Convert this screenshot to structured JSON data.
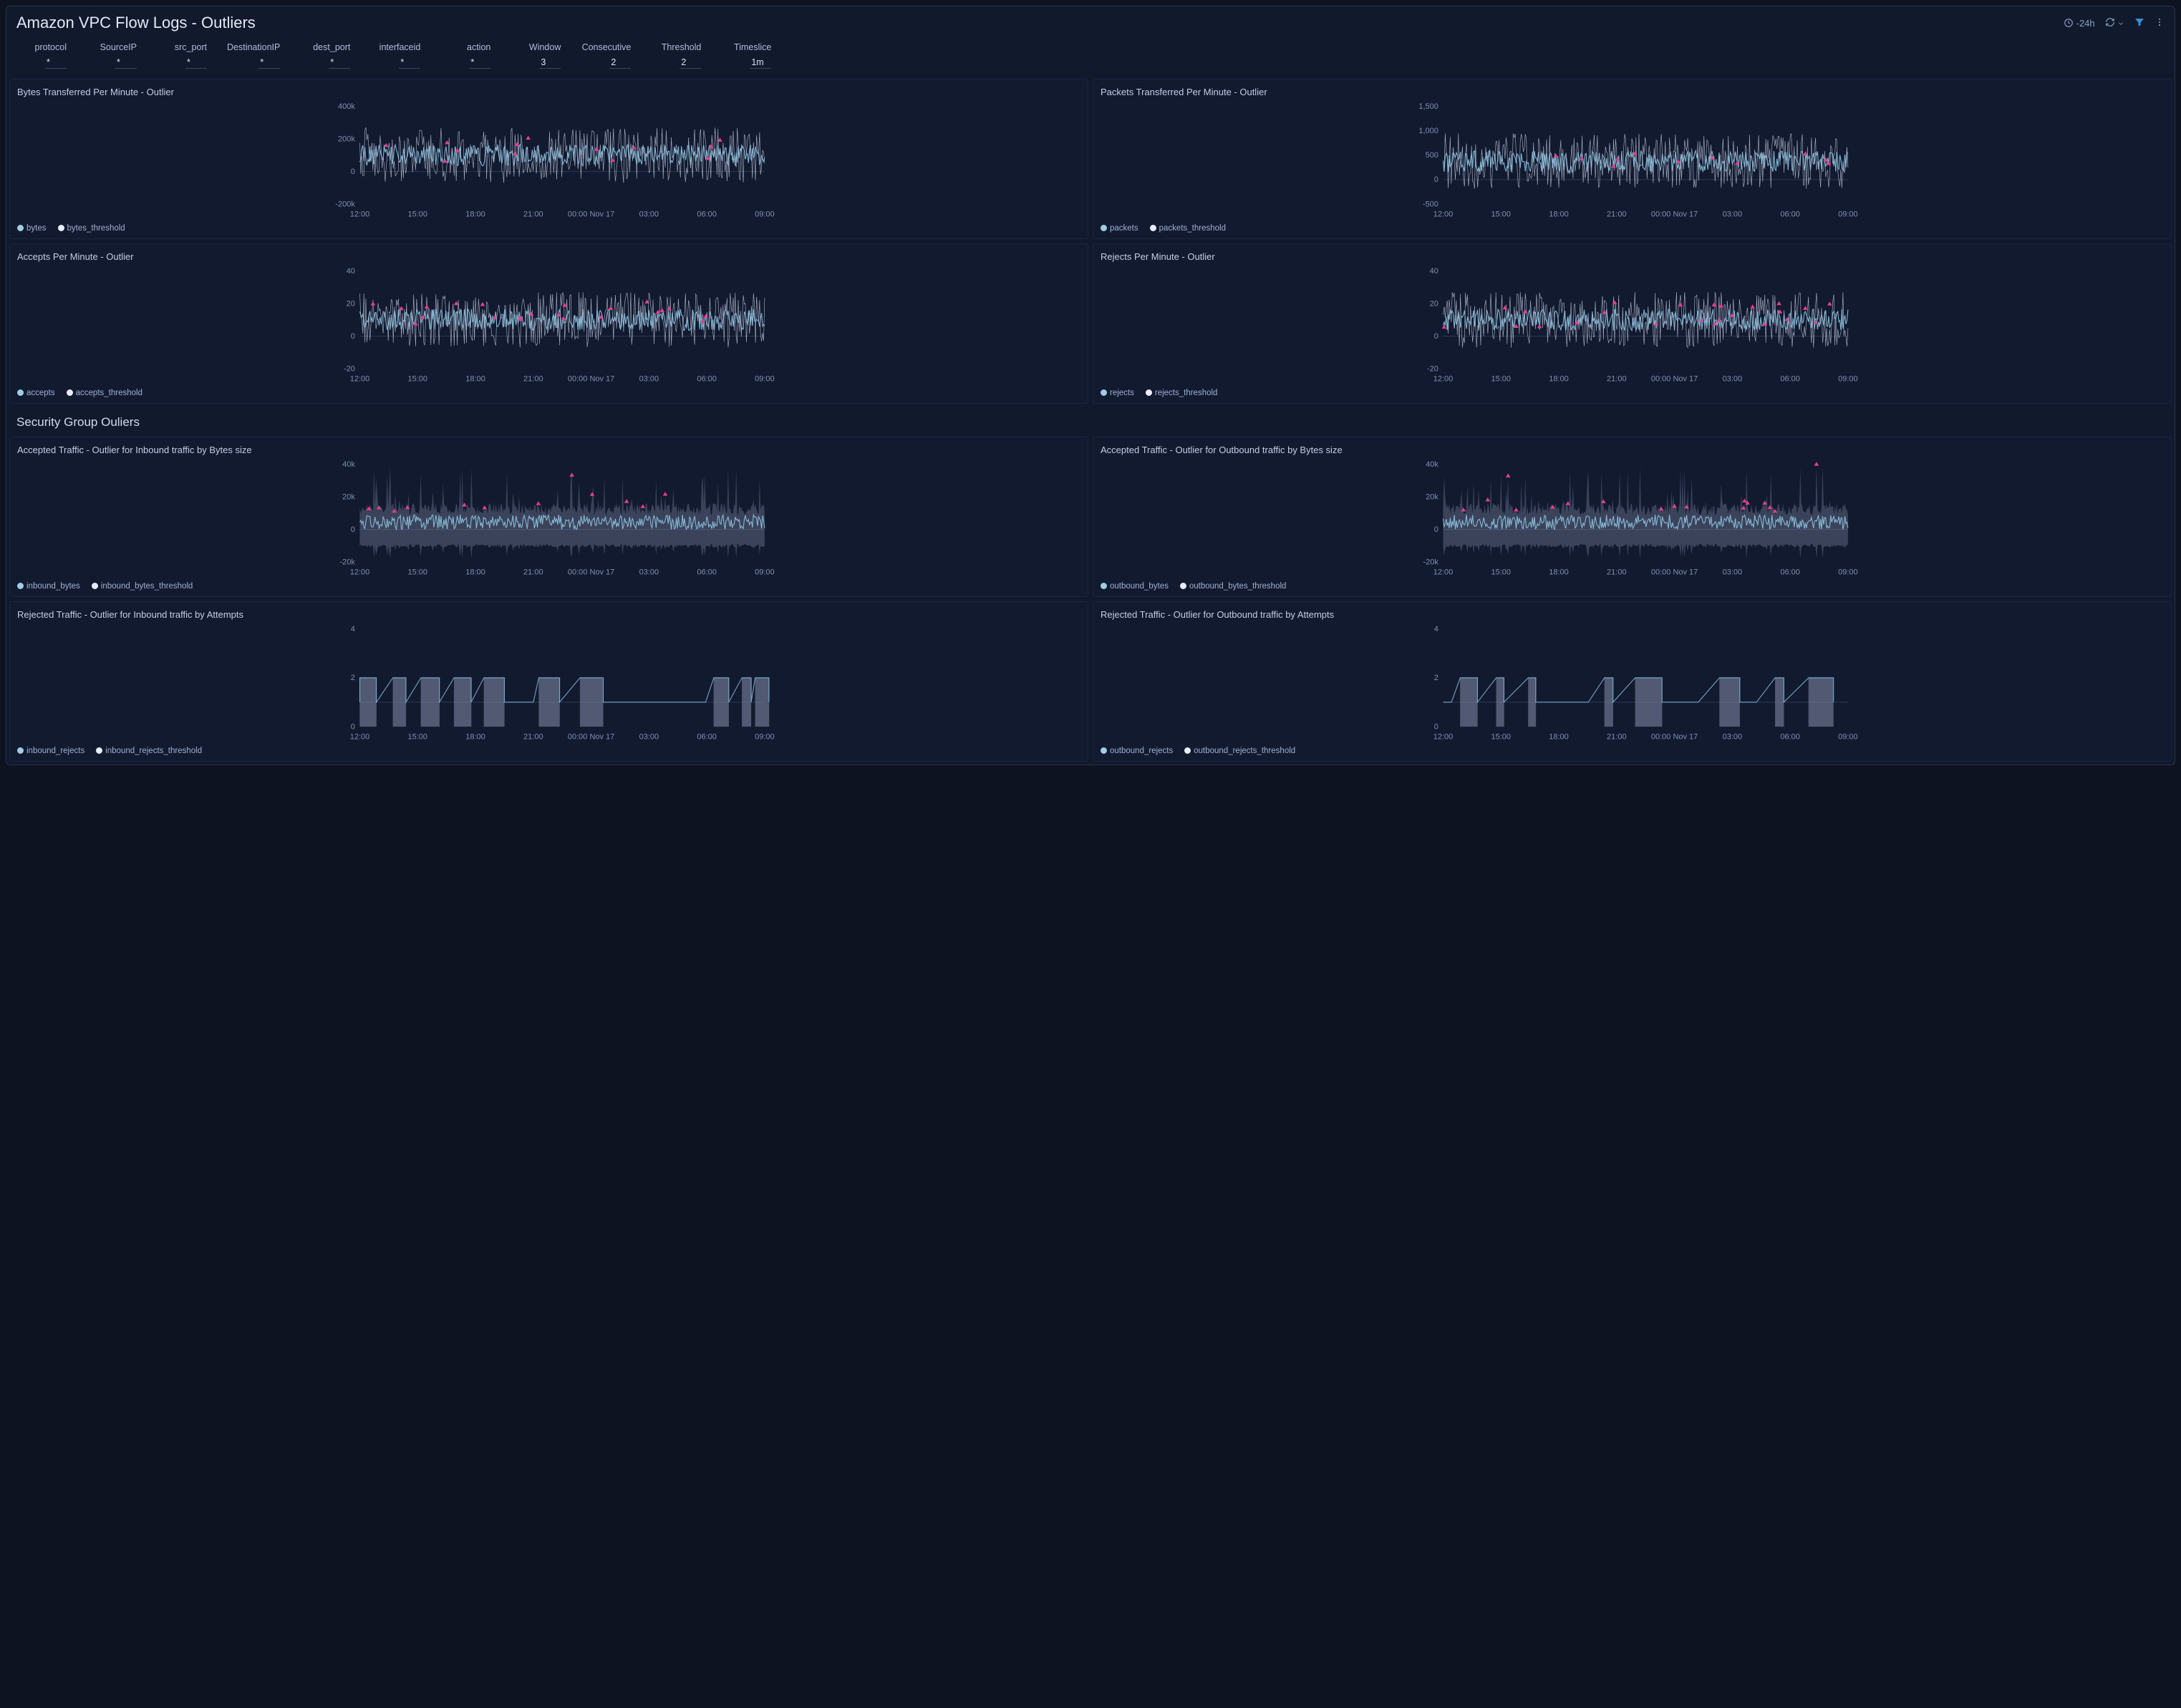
{
  "header": {
    "title": "Amazon VPC Flow Logs - Outliers",
    "timerange": "-24h"
  },
  "filters": [
    {
      "label": "protocol",
      "value": "*"
    },
    {
      "label": "SourceIP",
      "value": "*"
    },
    {
      "label": "src_port",
      "value": "*"
    },
    {
      "label": "DestinationIP",
      "value": "*"
    },
    {
      "label": "dest_port",
      "value": "*"
    },
    {
      "label": "interfaceid",
      "value": "*"
    },
    {
      "label": "action",
      "value": "*"
    },
    {
      "label": "Window",
      "value": "3"
    },
    {
      "label": "Consecutive",
      "value": "2"
    },
    {
      "label": "Threshold",
      "value": "2"
    },
    {
      "label": "Timeslice",
      "value": "1m"
    }
  ],
  "section2_title": "Security Group Ouliers",
  "chart_data": [
    {
      "id": "bytes",
      "title": "Bytes Transferred Per Minute - Outlier",
      "type": "line",
      "xlabel": "",
      "ylabel": "",
      "ylim": [
        -200000,
        400000
      ],
      "yticks": [
        "-200k",
        "0",
        "200k",
        "400k"
      ],
      "x_ticks": [
        "12:00",
        "15:00",
        "18:00",
        "21:00",
        "00:00 Nov 17",
        "03:00",
        "06:00",
        "09:00"
      ],
      "series": [
        {
          "name": "bytes",
          "color": "main"
        },
        {
          "name": "bytes_threshold",
          "color": "thresh"
        }
      ],
      "notes": "dense noisy band ~0–150k with scattered pink outlier markers across full window"
    },
    {
      "id": "packets",
      "title": "Packets Transferred Per Minute - Outlier",
      "type": "line",
      "ylim": [
        -500,
        1500
      ],
      "yticks": [
        "-500",
        "0",
        "500",
        "1,000",
        "1,500"
      ],
      "x_ticks": [
        "12:00",
        "15:00",
        "18:00",
        "21:00",
        "00:00 Nov 17",
        "03:00",
        "06:00",
        "09:00"
      ],
      "series": [
        {
          "name": "packets",
          "color": "main"
        },
        {
          "name": "packets_threshold",
          "color": "thresh"
        }
      ]
    },
    {
      "id": "accepts",
      "title": "Accepts Per Minute - Outlier",
      "type": "line",
      "ylim": [
        -20,
        40
      ],
      "yticks": [
        "-20",
        "0",
        "20",
        "40"
      ],
      "x_ticks": [
        "12:00",
        "15:00",
        "18:00",
        "21:00",
        "00:00 Nov 17",
        "03:00",
        "06:00",
        "09:00"
      ],
      "series": [
        {
          "name": "accepts",
          "color": "main"
        },
        {
          "name": "accepts_threshold",
          "color": "thresh"
        }
      ]
    },
    {
      "id": "rejects",
      "title": "Rejects Per Minute - Outlier",
      "type": "line",
      "ylim": [
        -20,
        40
      ],
      "yticks": [
        "-20",
        "0",
        "20",
        "40"
      ],
      "x_ticks": [
        "12:00",
        "15:00",
        "18:00",
        "21:00",
        "00:00 Nov 17",
        "03:00",
        "06:00",
        "09:00"
      ],
      "series": [
        {
          "name": "rejects",
          "color": "main"
        },
        {
          "name": "rejects_threshold",
          "color": "thresh"
        }
      ],
      "notes": "band is thinner, centered ~5–10, outliers sparser"
    },
    {
      "id": "inbound_bytes",
      "title": "Accepted Traffic - Outlier for Inbound traffic by Bytes size",
      "type": "area",
      "ylim": [
        -20000,
        40000
      ],
      "yticks": [
        "-20k",
        "0",
        "20k",
        "40k"
      ],
      "x_ticks": [
        "12:00",
        "15:00",
        "18:00",
        "21:00",
        "00:00 Nov 17",
        "03:00",
        "06:00",
        "09:00"
      ],
      "series": [
        {
          "name": "inbound_bytes",
          "color": "main"
        },
        {
          "name": "inbound_bytes_threshold",
          "color": "thresh"
        }
      ],
      "notes": "banded envelope ±~30k with bursts, pink markers at spikes"
    },
    {
      "id": "outbound_bytes",
      "title": "Accepted Traffic - Outlier for Outbound traffic by Bytes size",
      "type": "area",
      "ylim": [
        -20000,
        40000
      ],
      "yticks": [
        "-20k",
        "0",
        "20k",
        "40k"
      ],
      "x_ticks": [
        "12:00",
        "15:00",
        "18:00",
        "21:00",
        "00:00 Nov 17",
        "03:00",
        "06:00",
        "09:00"
      ],
      "series": [
        {
          "name": "outbound_bytes",
          "color": "main"
        },
        {
          "name": "outbound_bytes_threshold",
          "color": "thresh"
        }
      ]
    },
    {
      "id": "inbound_rejects",
      "title": "Rejected Traffic - Outlier for Inbound traffic by Attempts",
      "type": "area",
      "ylim": [
        0,
        4
      ],
      "yticks": [
        "0",
        "2",
        "4"
      ],
      "x_ticks": [
        "12:00",
        "15:00",
        "18:00",
        "21:00",
        "00:00 Nov 17",
        "03:00",
        "06:00",
        "09:00"
      ],
      "series": [
        {
          "name": "inbound_rejects",
          "color": "main"
        },
        {
          "name": "inbound_rejects_threshold",
          "color": "thresh"
        }
      ],
      "notes": "blocky rectangles 0–2 with a horizontal baseline at 1"
    },
    {
      "id": "outbound_rejects",
      "title": "Rejected Traffic - Outlier for Outbound traffic by Attempts",
      "type": "area",
      "ylim": [
        0,
        4
      ],
      "yticks": [
        "0",
        "2",
        "4"
      ],
      "x_ticks": [
        "12:00",
        "15:00",
        "18:00",
        "21:00",
        "00:00 Nov 17",
        "03:00",
        "06:00",
        "09:00"
      ],
      "series": [
        {
          "name": "outbound_rejects",
          "color": "main"
        },
        {
          "name": "outbound_rejects_threshold",
          "color": "thresh"
        }
      ]
    }
  ]
}
